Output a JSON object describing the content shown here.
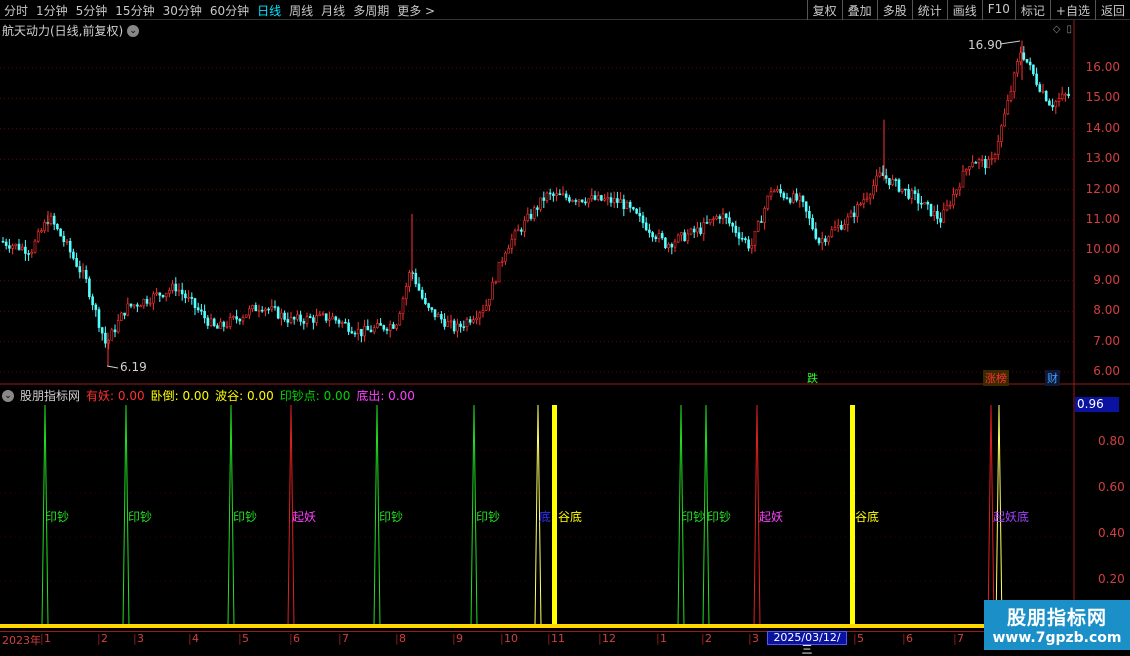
{
  "toolbar": {
    "periods": [
      "分时",
      "1分钟",
      "5分钟",
      "15分钟",
      "30分钟",
      "60分钟",
      "日线",
      "周线",
      "月线",
      "多周期",
      "更多 >"
    ],
    "active": "日线",
    "tools": [
      "复权",
      "叠加",
      "多股",
      "统计",
      "画线",
      "F10",
      "标记",
      "+自选",
      "返回"
    ]
  },
  "stock": {
    "title": "航天动力(日线,前复权)"
  },
  "price_axis": [
    "16.00",
    "15.00",
    "14.00",
    "13.00",
    "12.00",
    "11.00",
    "10.00",
    "9.00",
    "8.00",
    "7.00",
    "6.00"
  ],
  "annotations": {
    "high": "16.90",
    "low": "6.19"
  },
  "badges": {
    "die": "跌",
    "zhangting": "涨榜",
    "cai": "财"
  },
  "indicator": {
    "name": "股朋指标网",
    "fields": [
      {
        "label": "有妖: 0.00",
        "color": "#ff3030"
      },
      {
        "label": "卧倒: 0.00",
        "color": "#ffff00"
      },
      {
        "label": "波谷: 0.00",
        "color": "#ffff00"
      },
      {
        "label": "印钞点: 0.00",
        "color": "#00d800"
      },
      {
        "label": "底出: 0.00",
        "color": "#ff40ff"
      }
    ],
    "current_value": "0.96",
    "ticks": [
      "0.80",
      "0.60",
      "0.40",
      "0.20"
    ]
  },
  "signals": {
    "yinchao": "印钞",
    "qiyao": "起妖",
    "gudi": "谷底",
    "di": "底",
    "qiyao_di": "起妖底"
  },
  "time_axis": {
    "year": "2023年",
    "months": [
      "1",
      "2",
      "3",
      "4",
      "5",
      "6",
      "7",
      "8",
      "9",
      "10",
      "11",
      "12",
      "1",
      "2",
      "3",
      "5",
      "6",
      "7"
    ],
    "current_date": "2025/03/12/三"
  },
  "watermark": {
    "name": "股朋指标网",
    "url": "www.7gpzb.com"
  }
}
